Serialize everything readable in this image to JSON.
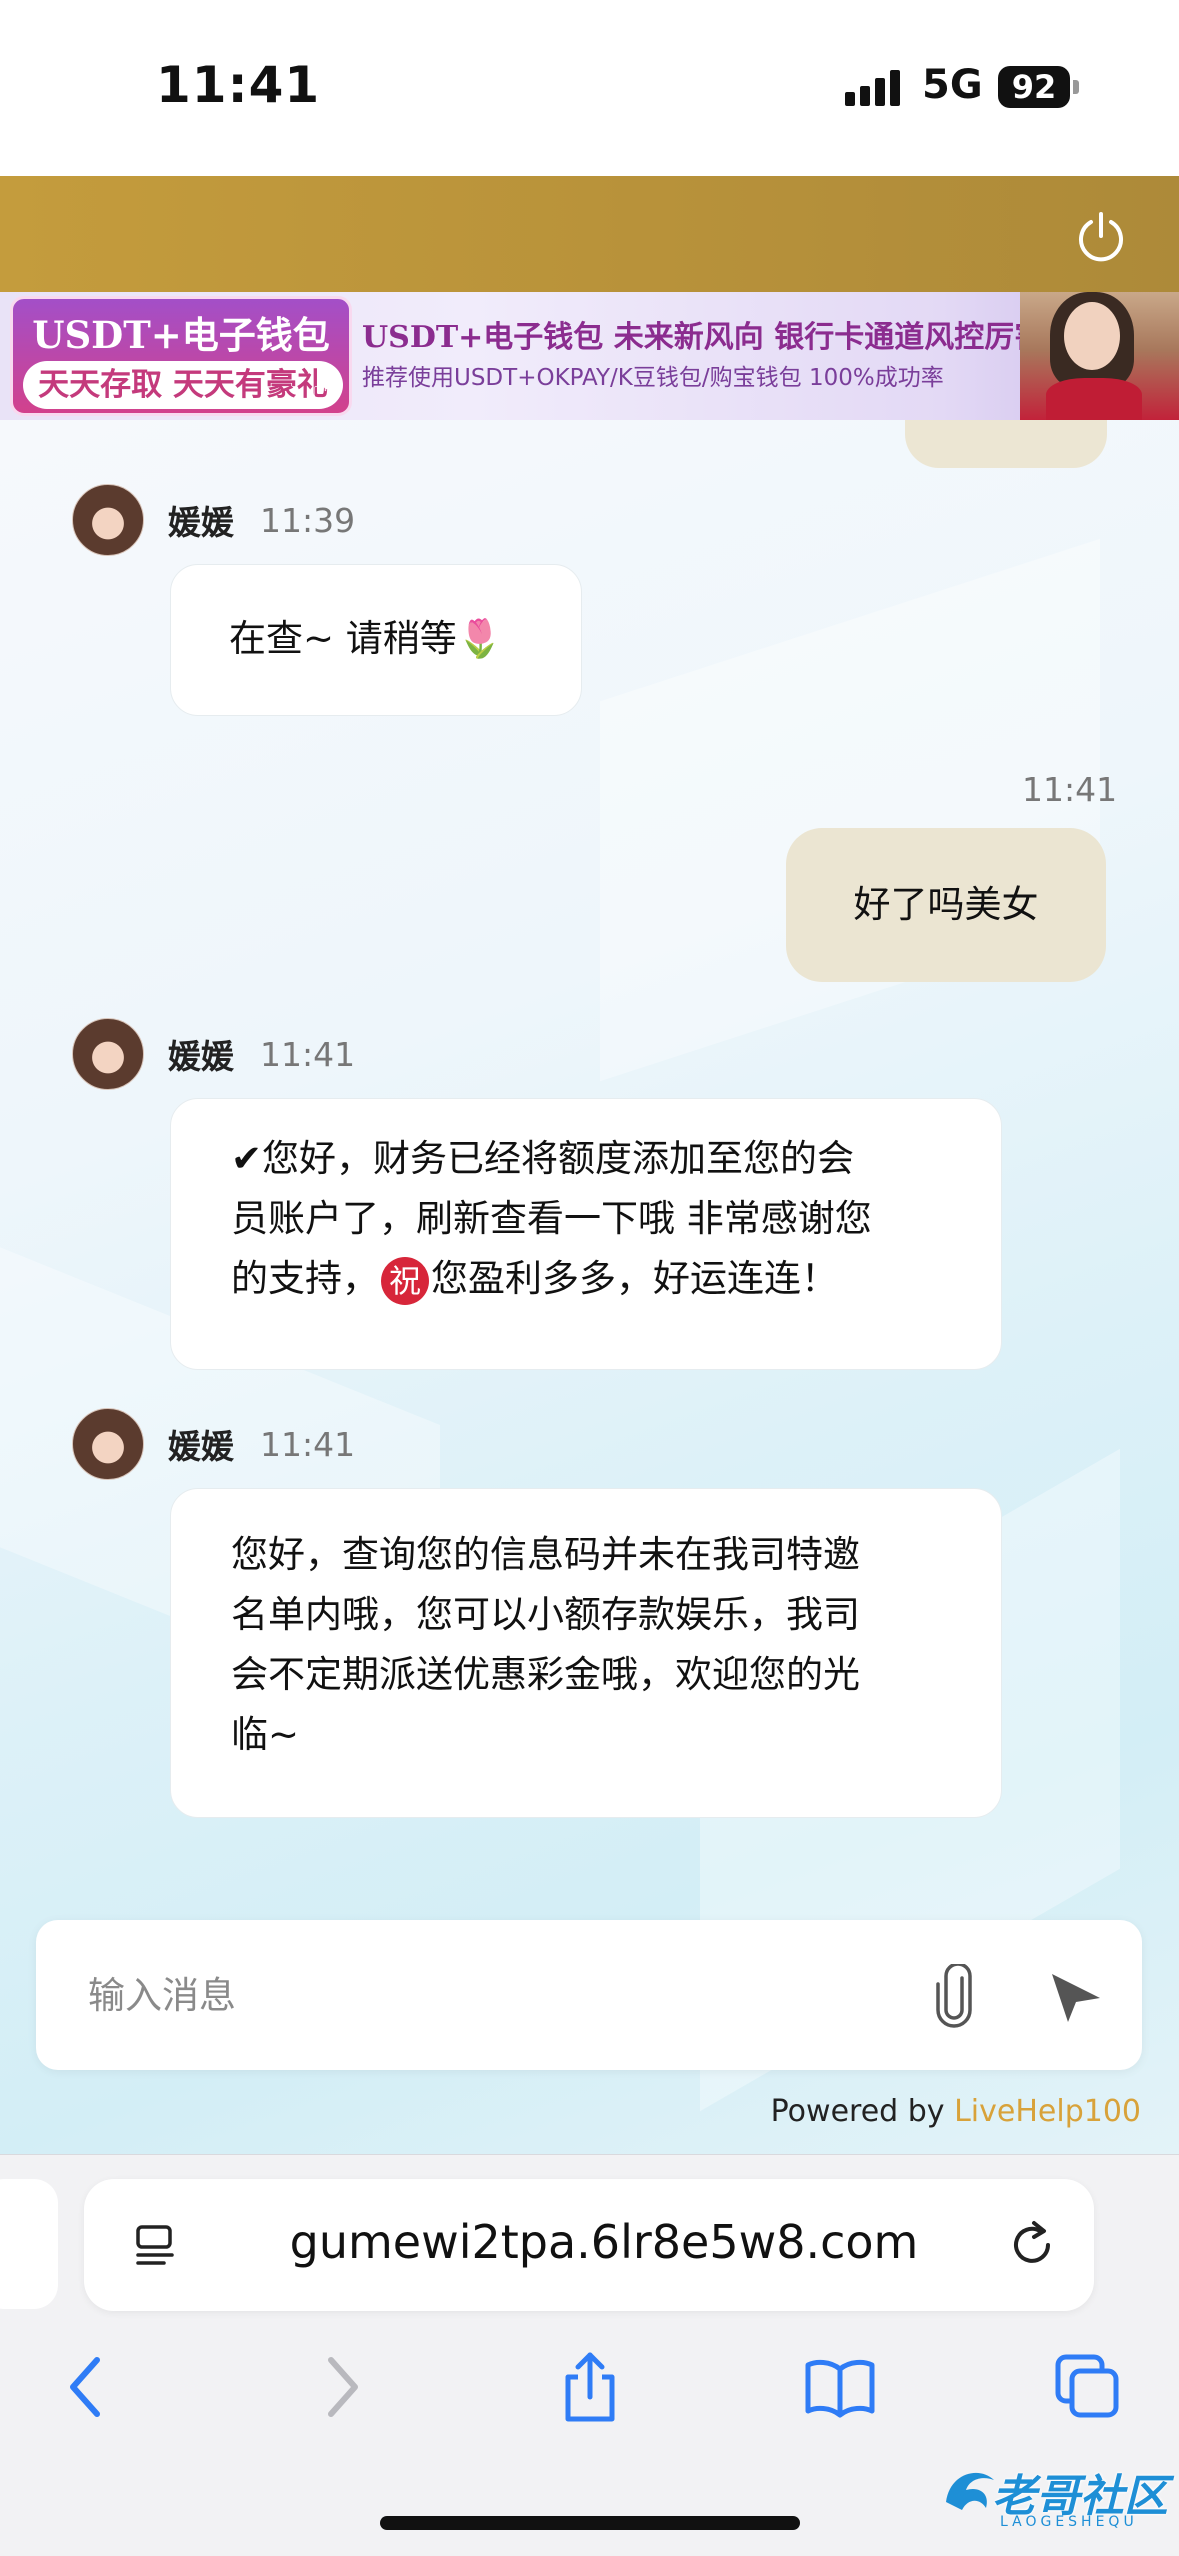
{
  "status_bar": {
    "time": "11:41",
    "network": "5G",
    "battery": "92"
  },
  "banner": {
    "left_top": "USDT+电子钱包",
    "left_bottom": "天天存取 天天有豪礼",
    "title": "USDT+电子钱包  未来新风向  银行卡通道风控厉害",
    "subtitle": "推荐使用USDT+OKPAY/K豆钱包/购宝钱包   100%成功率"
  },
  "messages": [
    {
      "sender": "媛媛",
      "time": "11:39",
      "text": "在查~ 请稍等🌷"
    },
    {
      "time": "11:41",
      "text": "好了吗美女"
    },
    {
      "sender": "媛媛",
      "time": "11:41",
      "line1": "✔您好，财务已经将额度添加至您的会",
      "line2": "员账户了，刷新查看一下哦 非常感谢您",
      "line3_a": "的支持，",
      "blessing": "祝",
      "line3_b": "您盈利多多，好运连连！"
    },
    {
      "sender": "媛媛",
      "time": "11:41",
      "line1": "您好，查询您的信息码并未在我司特邀",
      "line2": "名单内哦，您可以小额存款娱乐，我司",
      "line3": "会不定期派送优惠彩金哦，欢迎您的光",
      "line4": "临~"
    }
  ],
  "composer": {
    "placeholder": "输入消息"
  },
  "powered_by": {
    "prefix": "Powered by ",
    "brand": "LiveHelp100"
  },
  "browser": {
    "url": "gumewi2tpa.6lr8e5w8.com"
  },
  "watermark": {
    "text": "老哥社区",
    "sub": "LAOGESHEQU"
  },
  "colors": {
    "header_gold": "#b8923a",
    "outgoing_bubble": "#ebe5d2",
    "ios_blue": "#2f7cf6",
    "brand_orange": "#d8a23a"
  }
}
